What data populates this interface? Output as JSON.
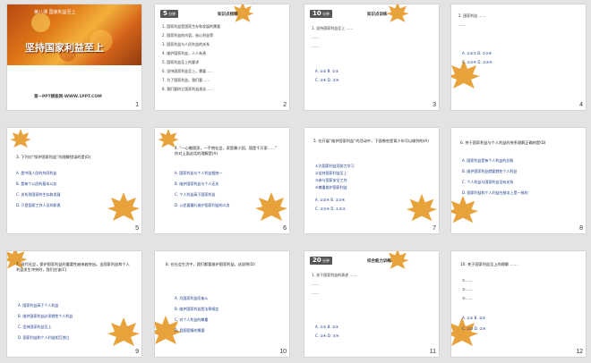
{
  "slides": [
    {
      "number": "1",
      "header": "第八课  国家利益至上",
      "title": "坚持国家利益至上",
      "footer": "第一PPT模板网-WWW.1PPT.COM"
    },
    {
      "number": "2",
      "badge_num": "5",
      "badge_text": "分钟",
      "section": "知识点梳理",
      "lines": [
        "1. 国家利益是国家生存和发展的需要",
        "2. 国家利益的内容，核心利益等",
        "3. 国家利益与人民利益的关系",
        "4. 维护国家利益，人人有责",
        "5. 国家利益至上的要求",
        "6. 坚持国家利益至上，需要……",
        "7. 为了国家利益，我们要……",
        "8. 我们要树立国家利益观念……"
      ]
    },
    {
      "number": "3",
      "badge_num": "10",
      "badge_text": "分钟",
      "section": "知识点训练",
      "lines": [
        "1. 坚持国家利益至上 ……",
        "……",
        "……",
        "A. ①②  B. ①③",
        "C. ②④  D. ③④"
      ]
    },
    {
      "number": "4",
      "lines": [
        "2. 国家利益 ……",
        "……",
        "A. ①②③  B. ①②④",
        "C. ①③④  D. ②③④"
      ]
    },
    {
      "number": "5",
      "q": "3. 下列对“保护国家利益”的理解错误的是(D)",
      "opts": [
        "A. 是中国人民的共同利益",
        "B. 是每个公民的基本义务",
        "C. 关系到国家的生存和发展",
        "D. 只是国家工作人员的职责"
      ]
    },
    {
      "number": "6",
      "q": "4. “一心敬国家，一手抱社会，家是最小国，国是千万家……” 你对上面这话的理解是(A)",
      "opts": [
        "A. 国家利益与个人利益相统一",
        "B. 维护国家利益与个人无关",
        "C. 个人利益高于国家利益",
        "D. 公民要履行维护国家利益的义务"
      ]
    },
    {
      "number": "7",
      "q": "5. 在开展“维护国家利益”的活动中，下面哪些是青少年可以做到的(A)",
      "opts": [
        "①为国家利益而努力学习",
        "②坚持国家利益至上",
        "③参与国家安全工作",
        "④尊重维护国家利益",
        "A. ①②④  B. ①③④",
        "C. ②③④  D. ①②③"
      ]
    },
    {
      "number": "8",
      "q": "6. 关于国家利益与个人利益的关系理解正确的是(D)",
      "opts": [
        "A. 国家利益是每个人利益的总和",
        "B. 维护国家利益就要牺牲个人利益",
        "C. 个人利益与国家利益没有关系",
        "D. 国家利益和个人利益在根本上是一致的"
      ]
    },
    {
      "number": "9",
      "q": "7. 现代社会，保护国家利益的重要性越来越突出。当国家利益和个人利益发生冲突时，我们应该(C)",
      "opts": [
        "A. 国家利益高于个人利益",
        "B. 维护国家利益必须牺牲个人利益",
        "C. 坚持国家利益至上",
        "D. 国家利益和个人利益相互独立"
      ]
    },
    {
      "number": "10",
      "q": "8. 在社会生活中，我们都要维护国家利益。这说明(D)",
      "opts": [
        "A. 为国家利益而奋斗",
        "B. 维护国家利益是法律规定",
        "C. 对个人利益的尊重",
        "D. 我国国情的需要"
      ]
    },
    {
      "number": "11",
      "badge_num": "20",
      "badge_text": "分钟",
      "section": "综合能力训练",
      "lines": [
        "1. 关于国家利益的表述 ……",
        "……",
        "……",
        "A. ①②  B. ②③",
        "C. ①④  D. ③④"
      ]
    },
    {
      "number": "12",
      "q": "10. 关于国家利益至上的理解 ……",
      "opts": [
        "①……",
        "②……",
        "③……",
        "A. ①②  B. ②③",
        "C. ①③  D. ②④"
      ]
    }
  ],
  "colors": {
    "accent": "#c44a00",
    "leaf": "#e8a23c",
    "red": "#cc0000",
    "option": "#1a3a8a"
  }
}
